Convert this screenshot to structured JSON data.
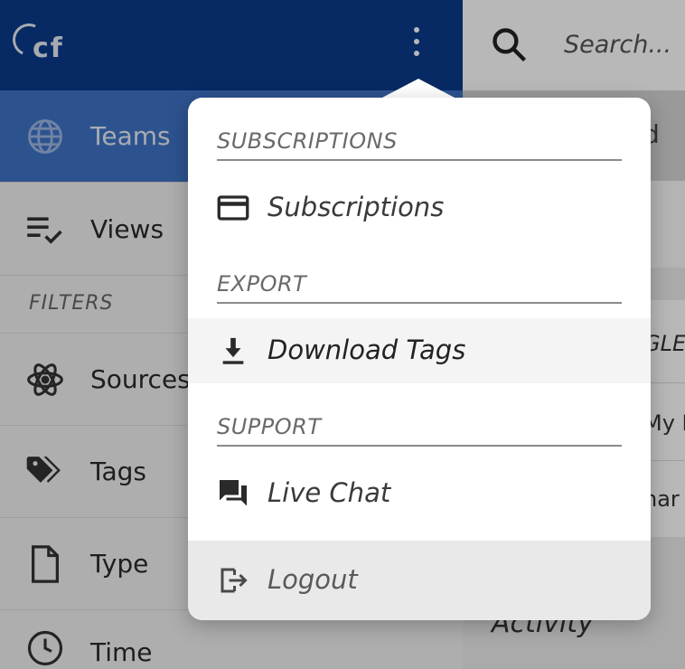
{
  "brand": {
    "logo_text": "cf"
  },
  "colors": {
    "topbar": "#0b3b8c",
    "active_nav": "#3f73c6",
    "menu_bg": "#ffffff"
  },
  "sidebar": {
    "items": [
      {
        "label": "Teams",
        "icon": "globe-icon",
        "active": true
      },
      {
        "label": "Views",
        "icon": "list-check-icon",
        "active": false
      }
    ],
    "filters_heading": "FILTERS",
    "filter_items": [
      {
        "label": "Sources",
        "icon": "atom-icon"
      },
      {
        "label": "Tags",
        "icon": "tags-icon"
      },
      {
        "label": "Type",
        "icon": "file-icon"
      },
      {
        "label": "Time",
        "icon": "clock-icon"
      }
    ]
  },
  "search": {
    "placeholder": "Search..."
  },
  "right_pane": {
    "panel_text": "d",
    "card_rows": [
      "GLE",
      "My D",
      "har"
    ],
    "activity_label": "Activity"
  },
  "menu": {
    "sections": [
      {
        "heading": "SUBSCRIPTIONS",
        "items": [
          {
            "label": "Subscriptions",
            "icon": "credit-card-icon"
          }
        ]
      },
      {
        "heading": "EXPORT",
        "items": [
          {
            "label": "Download Tags",
            "icon": "download-icon"
          }
        ]
      },
      {
        "heading": "SUPPORT",
        "items": [
          {
            "label": "Live Chat",
            "icon": "chat-icon"
          }
        ]
      }
    ],
    "logout": {
      "label": "Logout",
      "icon": "logout-icon"
    }
  }
}
